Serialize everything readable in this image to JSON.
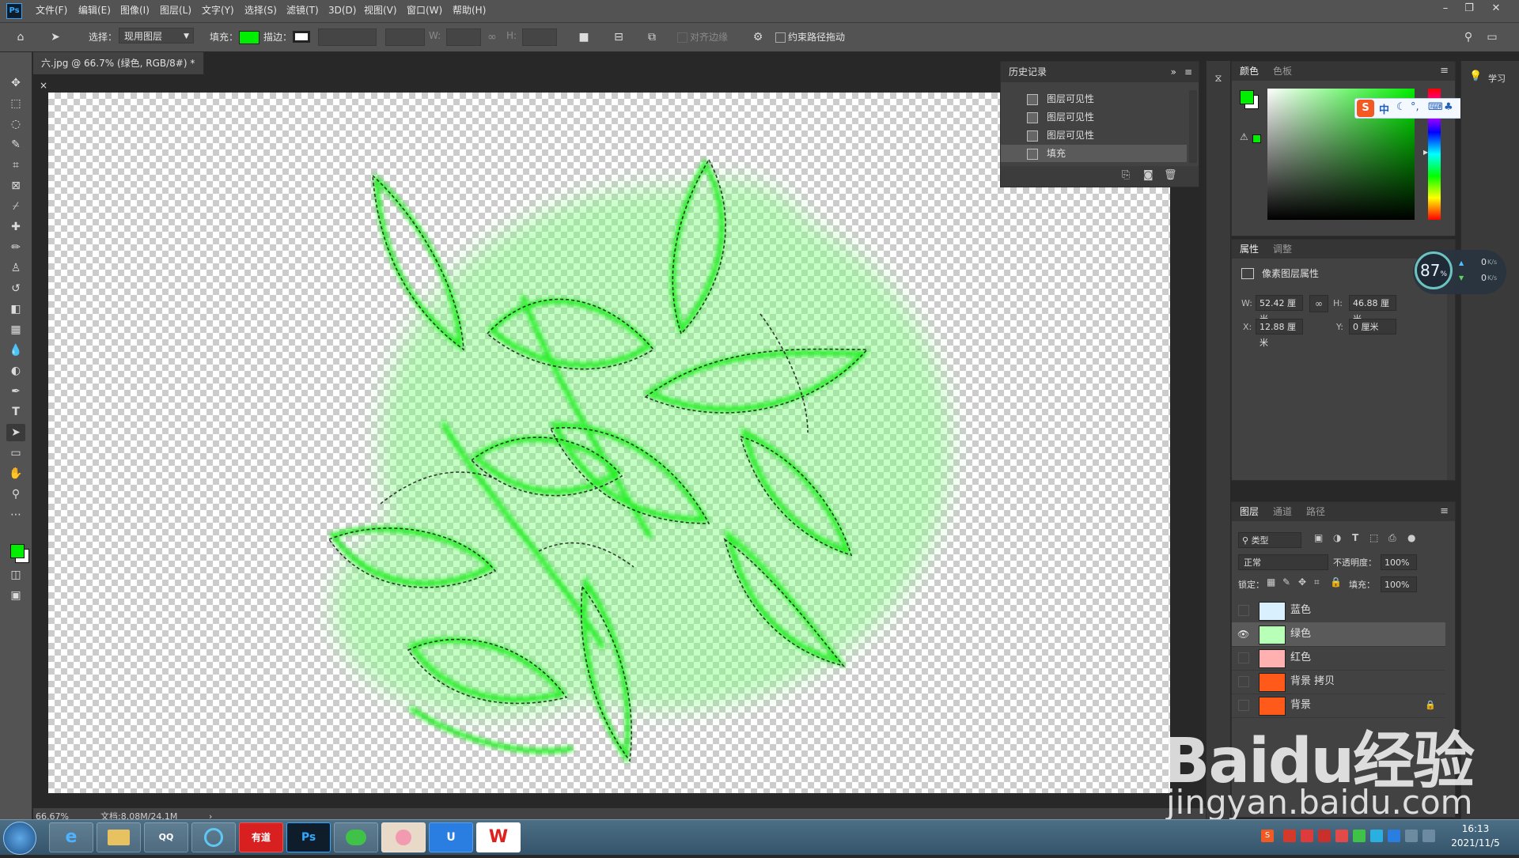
{
  "app": {
    "logo": "Ps"
  },
  "menu": [
    "文件(F)",
    "编辑(E)",
    "图像(I)",
    "图层(L)",
    "文字(Y)",
    "选择(S)",
    "滤镜(T)",
    "3D(D)",
    "视图(V)",
    "窗口(W)",
    "帮助(H)"
  ],
  "window_controls": {
    "minimize": "–",
    "restore": "❐",
    "close": "✕"
  },
  "options": {
    "select_label": "选择：",
    "select_value": "现用图层",
    "fill_label": "填充：",
    "fill_color": "#00ee00",
    "stroke_label": "描边：",
    "w_label": "W:",
    "h_label": "H:",
    "align_edges": "对齐边缘",
    "constrain_path": "约束路径拖动"
  },
  "doc": {
    "tab": "六.jpg @ 66.7% (绿色, RGB/8#) *",
    "close": "×"
  },
  "status": {
    "zoom": "66.67%",
    "doc_size": "文档:8.08M/24.1M",
    "arrow": "›"
  },
  "history": {
    "title": "历史记录",
    "rows": [
      "图层可见性",
      "图层可见性",
      "图层可见性",
      "填充"
    ]
  },
  "color_panel": {
    "tab_color": "颜色",
    "tab_swatches": "色板",
    "fg": "#00ee00"
  },
  "ime": {
    "zh": "中"
  },
  "learn": {
    "label": "学习"
  },
  "properties": {
    "tab_props": "属性",
    "tab_adjust": "调整",
    "subtitle": "像素图层属性",
    "w_label": "W:",
    "w_value": "52.42 厘米",
    "h_label": "H:",
    "h_value": "46.88 厘米",
    "x_label": "X:",
    "x_value": "12.88 厘米",
    "y_label": "Y:",
    "y_value": "0 厘米"
  },
  "perf": {
    "percent": "87",
    "unit": "%",
    "up": "0",
    "down": "0",
    "rate_unit": "K/s"
  },
  "layers": {
    "tab_layers": "图层",
    "tab_channels": "通道",
    "tab_paths": "路径",
    "filter": "类型",
    "blend": "正常",
    "opacity_label": "不透明度：",
    "opacity": "100%",
    "lock_label": "锁定：",
    "fill_label": "填充：",
    "fill": "100%",
    "rows": [
      {
        "name": "蓝色",
        "visible": false,
        "thumb": "#d9f0ff"
      },
      {
        "name": "绿色",
        "visible": true,
        "thumb": "#b8ffb8"
      },
      {
        "name": "红色",
        "visible": false,
        "thumb": "#ffb0b0"
      },
      {
        "name": "背景 拷贝",
        "visible": false,
        "thumb": "#ff5a1a"
      },
      {
        "name": "背景",
        "visible": false,
        "thumb": "#ff5a1a"
      }
    ]
  },
  "taskbar": {
    "apps": [
      "e",
      "",
      "QQ",
      "",
      "有道",
      "Ps",
      "",
      "",
      "U",
      "W"
    ],
    "clock_time": "16:13",
    "clock_date": "2021/11/5"
  },
  "watermark": {
    "brand": "Baidu经验",
    "url": "jingyan.baidu.com"
  }
}
